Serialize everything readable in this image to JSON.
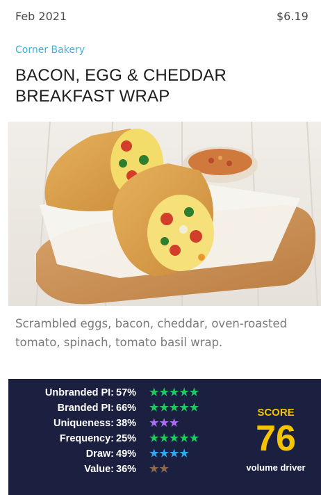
{
  "header": {
    "date": "Feb 2021",
    "price": "$6.19"
  },
  "item": {
    "brand": "Corner Bakery",
    "title": "BACON, EGG & CHEDDAR BREAKFAST WRAP",
    "description": "Scrambled eggs, bacon, cheddar, oven-roasted tomato, spinach, tomato basil wrap.",
    "image_subject": "breakfast-wrap-photo"
  },
  "metrics": [
    {
      "label": "Unbranded PI:",
      "value": "57%",
      "stars": 5,
      "color": "#22c55e"
    },
    {
      "label": "Branded PI:",
      "value": "66%",
      "stars": 5,
      "color": "#22c55e"
    },
    {
      "label": "Uniqueness:",
      "value": "38%",
      "stars": 3,
      "color": "#b06bf0"
    },
    {
      "label": "Frequency:",
      "value": "25%",
      "stars": 5,
      "color": "#22c55e"
    },
    {
      "label": "Draw:",
      "value": "49%",
      "stars": 4,
      "color": "#2fa8f0"
    },
    {
      "label": "Value:",
      "value": "36%",
      "stars": 2,
      "color": "#8a6a4a"
    }
  ],
  "score": {
    "label": "SCORE",
    "value": "76",
    "subtitle": "volume driver"
  },
  "colors": {
    "brand": "#3db2e0",
    "panel": "#1b2040",
    "score": "#f5c400"
  }
}
